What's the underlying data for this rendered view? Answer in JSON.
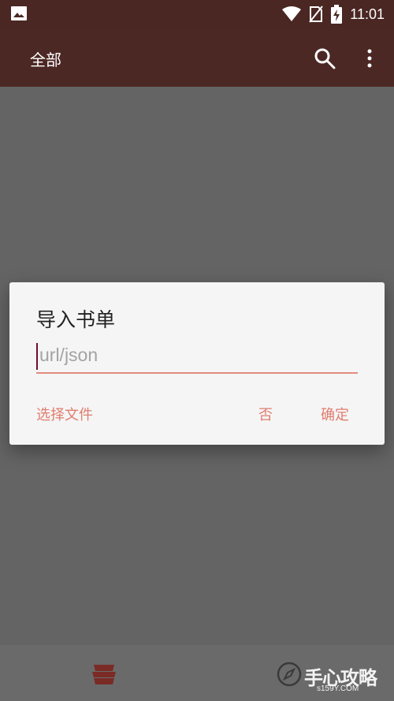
{
  "status_bar": {
    "time": "11:01",
    "icons": [
      "image-icon",
      "wifi-icon",
      "no-sim-icon",
      "battery-charging-icon"
    ]
  },
  "app_bar": {
    "title": "全部",
    "icons": [
      "search-icon",
      "more-vert-icon"
    ]
  },
  "dialog": {
    "title": "导入书单",
    "input": {
      "placeholder": "url/json",
      "value": ""
    },
    "buttons": {
      "choose_file": "选择文件",
      "no": "否",
      "ok": "确定"
    }
  },
  "bottom_nav": {
    "icons": [
      "app-logo-icon",
      "compass-icon"
    ],
    "watermark": "手心攻略",
    "watermark_url": "s159Y.COM"
  },
  "colors": {
    "app_bar": "#4c2825",
    "status_bar": "#4a2723",
    "scrim": "#646464",
    "accent": "#e07d6f",
    "caret": "#6d0d2d"
  }
}
